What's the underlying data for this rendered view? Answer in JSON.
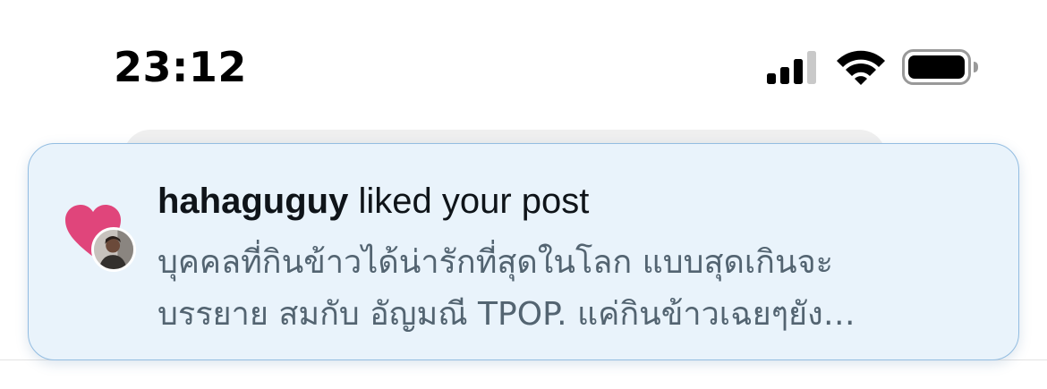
{
  "status_bar": {
    "time": "23:12",
    "signal_icon": "cellular-signal-icon",
    "wifi_icon": "wifi-icon",
    "battery_icon": "battery-icon"
  },
  "notification": {
    "username": "hahaguguy",
    "action_text": " liked your post",
    "post_preview_line1": "บุคคลที่กินข้าวได้น่ารักที่สุดในโลก แบบสุดเกินจะ",
    "post_preview_line2": "บรรยาย สมกับ อัญมณี TPOP. แค่กินข้าวเฉยๆยัง…",
    "icon": "heart-icon",
    "accent_color": "#e0457b",
    "background_color": "#e9f3fb",
    "border_color": "#93bde1"
  }
}
